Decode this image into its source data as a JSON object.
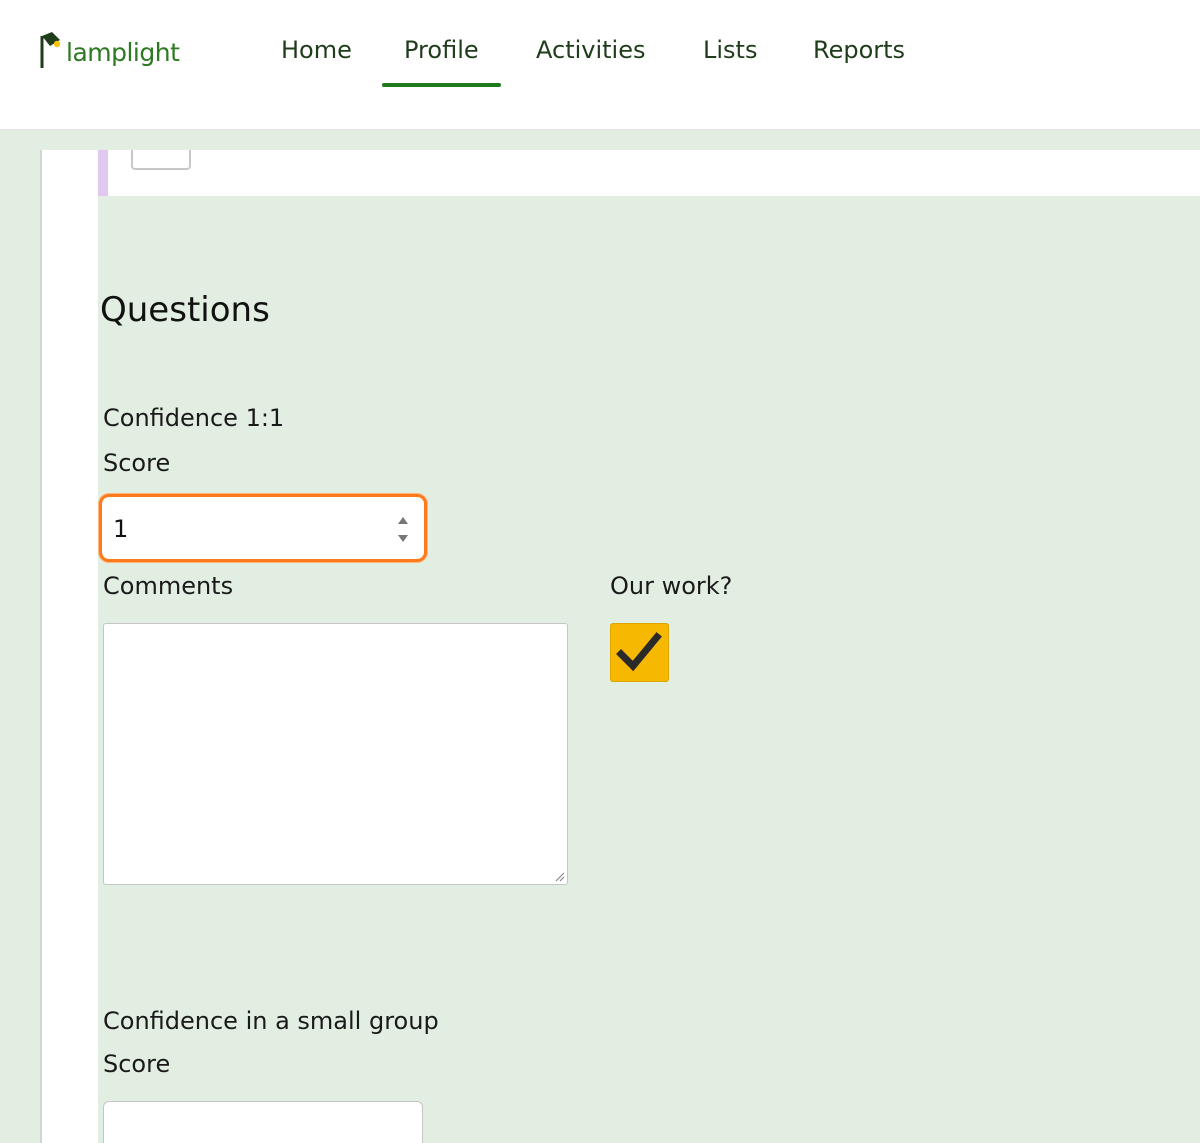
{
  "brand": {
    "name": "lamplight"
  },
  "nav": {
    "items": [
      {
        "label": "Home"
      },
      {
        "label": "Profile",
        "active": true
      },
      {
        "label": "Activities"
      },
      {
        "label": "Lists"
      },
      {
        "label": "Reports"
      }
    ]
  },
  "questions": {
    "heading": "Questions",
    "items": [
      {
        "title": "Confidence 1:1",
        "score_label": "Score",
        "score_value": "1",
        "comments_label": "Comments",
        "comments_value": "",
        "our_work_label": "Our work?",
        "our_work_checked": true
      },
      {
        "title": "Confidence in a small group",
        "score_label": "Score",
        "score_value": ""
      }
    ]
  },
  "colors": {
    "brand_green": "#2c7a21",
    "focus_orange": "#ff7a1a",
    "checkbox_yellow": "#f6b800",
    "panel_bg": "#e2eee1"
  }
}
